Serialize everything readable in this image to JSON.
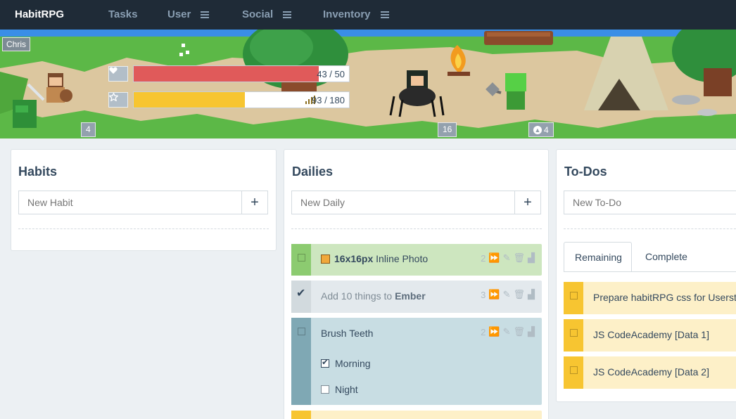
{
  "navbar": {
    "brand": "HabitRPG",
    "items": [
      {
        "label": "Tasks",
        "menu": false
      },
      {
        "label": "User",
        "menu": true
      },
      {
        "label": "Social",
        "menu": true
      },
      {
        "label": "Inventory",
        "menu": true
      }
    ]
  },
  "header": {
    "player_name": "Chris",
    "health": {
      "value": 43,
      "max": 50,
      "text": "43 / 50",
      "icon": "heart-icon",
      "color": "#e05a5a"
    },
    "experience": {
      "value": 93,
      "max": 180,
      "text": "93 / 180",
      "icon": "star-icon",
      "color": "#f7c531"
    },
    "party_levels": [
      "4",
      "16",
      "4"
    ]
  },
  "habits": {
    "title": "Habits",
    "new_placeholder": "New Habit",
    "add_label": "+"
  },
  "dailies": {
    "title": "Dailies",
    "new_placeholder": "New Daily",
    "add_label": "+",
    "items": [
      {
        "bold": "16x16px",
        "text": " Inline Photo",
        "streak": "2",
        "color": "#cde6bf",
        "strip": "#8ccb70",
        "checked": false
      },
      {
        "pre": "Add 10 things to ",
        "bold": "Ember",
        "streak": "3",
        "color": "#e3e9ed",
        "strip": "#d2dade",
        "checked": true
      },
      {
        "text": "Brush Teeth",
        "streak": "2",
        "color": "#c8dde3",
        "strip": "#7fa8b4",
        "checked": false,
        "checklist": [
          {
            "label": "Morning",
            "checked": true
          },
          {
            "label": "Night",
            "checked": false
          }
        ]
      }
    ]
  },
  "todos": {
    "title": "To-Dos",
    "new_placeholder": "New To-Do",
    "tabs": [
      "Remaining",
      "Complete"
    ],
    "items": [
      {
        "text": "Prepare habitRPG css for Userstyles"
      },
      {
        "text": "JS CodeAcademy [Data 1]"
      },
      {
        "text": "JS CodeAcademy [Data 2]"
      }
    ]
  },
  "colors": {
    "navbar": "#1f2b37",
    "todo_bg": "#fdf0c8",
    "todo_strip": "#f7c531"
  }
}
